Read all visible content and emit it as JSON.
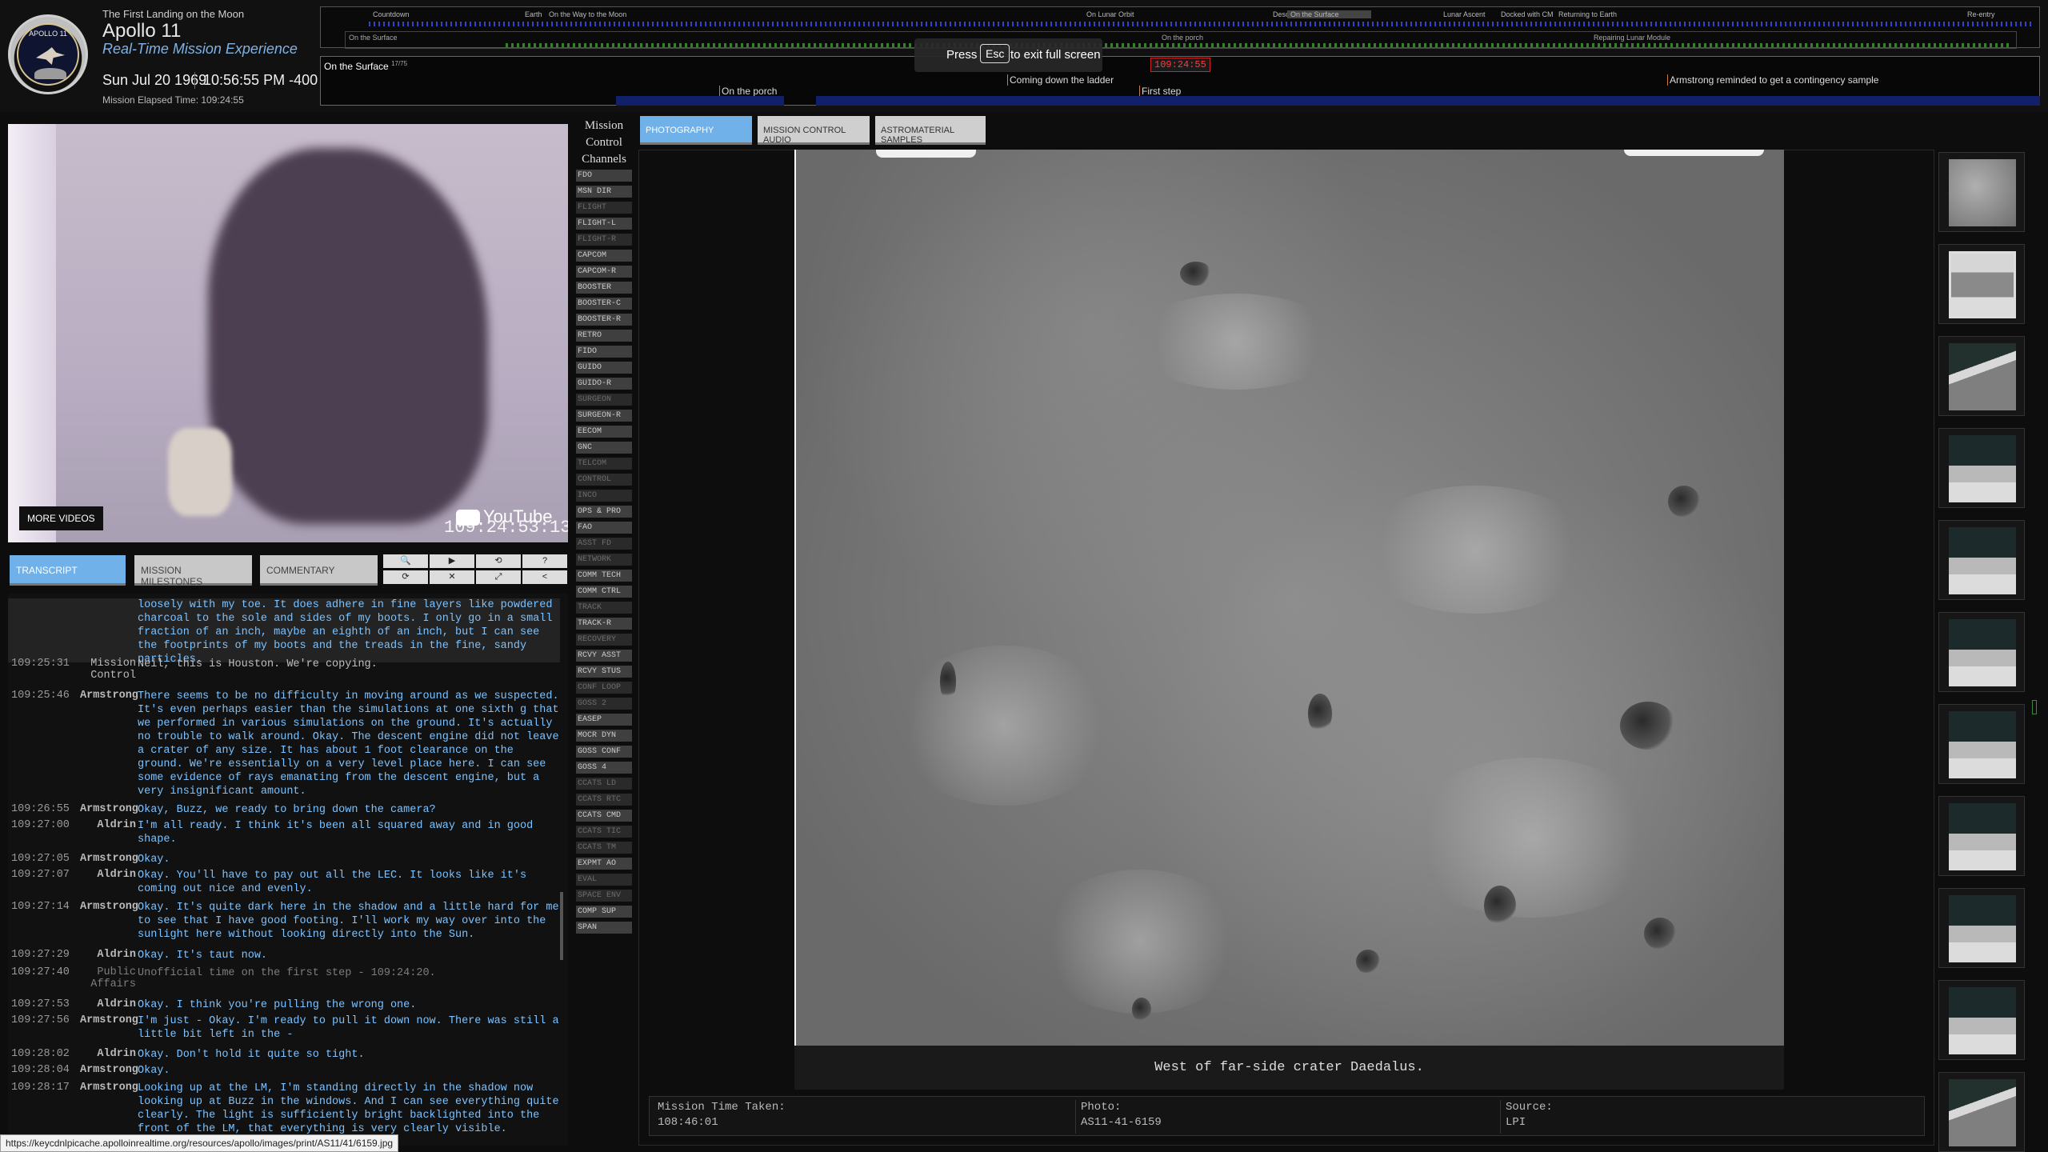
{
  "header": {
    "subtitle": "The First Landing on the Moon",
    "title": "Apollo 11",
    "tagline": "Real-Time Mission Experience",
    "date": "Sun Jul 20 1969",
    "time": "10:56:55 PM -400",
    "met": "Mission Elapsed Time: 109:24:55",
    "logo_text": "APOLLO 11"
  },
  "timeline": {
    "phases": [
      "Countdown",
      "Earth",
      "On the Way to the Moon",
      "On Lunar Orbit",
      "Desc",
      "On the Surface",
      "Lunar Ascent",
      "Docked with CM",
      "Returning to Earth",
      "Re-entry"
    ],
    "sub_label": "On the Surface",
    "sub_porch": "On the porch",
    "sub_event": "Repairing Lunar Module",
    "bottom_label": "On the Surface",
    "bottom_count": "17/75",
    "current_time": "109:24:55",
    "events": [
      "On the porch",
      "Coming down the ladder",
      "First step",
      "Armstrong reminded to get a contingency sample"
    ]
  },
  "esc_notice": {
    "press": "Press",
    "key": "Esc",
    "rest": "to exit full screen"
  },
  "video": {
    "more_videos": "MORE VIDEOS",
    "youtube": "YouTube",
    "timecode": "109:24:53:13"
  },
  "left_tabs": [
    "TRANSCRIPT",
    "MISSION MILESTONES",
    "COMMENTARY"
  ],
  "controls": {
    "search": "search-icon",
    "play": "play-icon",
    "history": "history-icon",
    "help": "help-icon",
    "reload": "reload-icon",
    "mute": "mute-icon",
    "fullscreen": "fullscreen-icon",
    "share": "share-icon",
    "glyphs": [
      "🔍",
      "▶",
      "⟲",
      "?",
      "⟳",
      "✕",
      "⤢",
      "<"
    ]
  },
  "transcript": [
    {
      "ts": "",
      "who": "",
      "text": "loosely with my toe. It does adhere in fine layers like powdered charcoal to the sole and sides of my boots. I only go in a small fraction of an inch, maybe an eighth of an inch, but I can see the footprints of my boots and the treads in the fine, sandy particles.",
      "kind": "hl"
    },
    {
      "ts": "109:25:31",
      "who": "Mission Control",
      "text": "Neil, this is Houston. We're copying.",
      "kind": "mc"
    },
    {
      "ts": "109:25:46",
      "who": "Armstrong",
      "text": "There seems to be no difficulty in moving around as we suspected. It's even perhaps easier than the simulations at one sixth g that we performed in various simulations on the ground. It's actually no trouble to walk around. Okay. The descent engine did not leave a crater of any size. It has about 1 foot clearance on the ground. We're essentially on a very level place here. I can see some evidence of rays emanating from the descent engine, but a very insignificant amount.",
      "kind": "n"
    },
    {
      "ts": "109:26:55",
      "who": "Armstrong",
      "text": "Okay, Buzz, we ready to bring down the camera?",
      "kind": "n"
    },
    {
      "ts": "109:27:00",
      "who": "Aldrin",
      "text": "I'm all ready. I think it's been all squared away and in good shape.",
      "kind": "n"
    },
    {
      "ts": "109:27:05",
      "who": "Armstrong",
      "text": "Okay.",
      "kind": "n"
    },
    {
      "ts": "109:27:07",
      "who": "Aldrin",
      "text": "Okay. You'll have to pay out all the LEC. It looks like it's coming out nice and evenly.",
      "kind": "n"
    },
    {
      "ts": "109:27:14",
      "who": "Armstrong",
      "text": "Okay. It's quite dark here in the shadow and a little hard for me to see that I have good footing. I'll work my way over into the sunlight here without looking directly into the Sun.",
      "kind": "n"
    },
    {
      "ts": "109:27:29",
      "who": "Aldrin",
      "text": "Okay. It's taut now.",
      "kind": "n"
    },
    {
      "ts": "109:27:40",
      "who": "Public Affairs",
      "text": "Unofficial time on the first step - 109:24:20.",
      "kind": "pa"
    },
    {
      "ts": "109:27:53",
      "who": "Aldrin",
      "text": "Okay. I think you're pulling the wrong one.",
      "kind": "n"
    },
    {
      "ts": "109:27:56",
      "who": "Armstrong",
      "text": "I'm just - Okay. I'm ready to pull it down now. There was still a little bit left in the -",
      "kind": "n"
    },
    {
      "ts": "109:28:02",
      "who": "Aldrin",
      "text": "Okay. Don't hold it quite so tight.",
      "kind": "n"
    },
    {
      "ts": "109:28:04",
      "who": "Armstrong",
      "text": "Okay.",
      "kind": "n"
    },
    {
      "ts": "109:28:17",
      "who": "Armstrong",
      "text": "Looking up at the LM, I'm standing directly in the shadow now looking up at Buzz in the windows. And I can see everything quite clearly. The light is sufficiently bright backlighted into the front of the LM, that everything is very clearly visible.",
      "kind": "n"
    }
  ],
  "status_url": "https://keycdnlpicache.apolloinrealtime.org/resources/apollo/images/print/AS11/41/6159.jpg",
  "channels": {
    "title": "Mission Control Channels",
    "items": [
      {
        "label": "FDO",
        "on": true
      },
      {
        "label": "MSN DIR",
        "on": true
      },
      {
        "label": "FLIGHT",
        "on": false
      },
      {
        "label": "FLIGHT-L",
        "on": true
      },
      {
        "label": "FLIGHT-R",
        "on": false
      },
      {
        "label": "CAPCOM",
        "on": true
      },
      {
        "label": "CAPCOM-R",
        "on": true
      },
      {
        "label": "BOOSTER",
        "on": true
      },
      {
        "label": "BOOSTER-C",
        "on": true
      },
      {
        "label": "BOOSTER-R",
        "on": true
      },
      {
        "label": "RETRO",
        "on": true
      },
      {
        "label": "FIDO",
        "on": true
      },
      {
        "label": "GUIDO",
        "on": true
      },
      {
        "label": "GUIDO-R",
        "on": true
      },
      {
        "label": "SURGEON",
        "on": false
      },
      {
        "label": "SURGEON-R",
        "on": true
      },
      {
        "label": "EECOM",
        "on": true
      },
      {
        "label": "GNC",
        "on": true
      },
      {
        "label": "TELCOM",
        "on": false
      },
      {
        "label": "CONTROL",
        "on": false
      },
      {
        "label": "INCO",
        "on": false
      },
      {
        "label": "OPS & PRO",
        "on": true
      },
      {
        "label": "FAO",
        "on": true
      },
      {
        "label": "ASST FD",
        "on": false
      },
      {
        "label": "NETWORK",
        "on": false
      },
      {
        "label": "COMM TECH",
        "on": true
      },
      {
        "label": "COMM CTRL",
        "on": true
      },
      {
        "label": "TRACK",
        "on": false
      },
      {
        "label": "TRACK-R",
        "on": true
      },
      {
        "label": "RECOVERY",
        "on": false
      },
      {
        "label": "RCVY ASST",
        "on": true
      },
      {
        "label": "RCVY STUS",
        "on": true
      },
      {
        "label": "CONF LOOP",
        "on": false
      },
      {
        "label": "GOSS 2",
        "on": false
      },
      {
        "label": "EASEP",
        "on": true
      },
      {
        "label": "MOCR DYN",
        "on": true
      },
      {
        "label": "GOSS CONF",
        "on": true
      },
      {
        "label": "GOSS 4",
        "on": true
      },
      {
        "label": "CCATS LD",
        "on": false
      },
      {
        "label": "CCATS RTC",
        "on": false
      },
      {
        "label": "CCATS CMD",
        "on": true
      },
      {
        "label": "CCATS TIC",
        "on": false
      },
      {
        "label": "CCATS TM",
        "on": false
      },
      {
        "label": "EXPMT AO",
        "on": true
      },
      {
        "label": "EVAL",
        "on": false
      },
      {
        "label": "SPACE ENV",
        "on": false
      },
      {
        "label": "COMP SUP",
        "on": true
      },
      {
        "label": "SPAN",
        "on": true
      }
    ]
  },
  "main_tabs": [
    "PHOTOGRAPHY",
    "MISSION CONTROL AUDIO",
    "ASTROMATERIAL SAMPLES"
  ],
  "photo": {
    "caption": "West of far-side crater Daedalus.",
    "taken_label": "Mission Time Taken:",
    "taken_value": "108:46:01",
    "photo_label": "Photo:",
    "photo_value": "AS11-41-6159",
    "source_label": "Source:",
    "source_value": "LPI"
  },
  "thumbnails": [
    "lunar-surface",
    "lm-window",
    "lm-leg",
    "surface-horizon",
    "surface-horizon",
    "surface-horizon",
    "surface-horizon",
    "surface-horizon",
    "surface-horizon",
    "surface-horizon",
    "lm-leg"
  ],
  "colors": {
    "accent": "#6fb1e8",
    "transcript_text": "#7cc2ff",
    "timeline_marker": "#ff3b3b"
  }
}
